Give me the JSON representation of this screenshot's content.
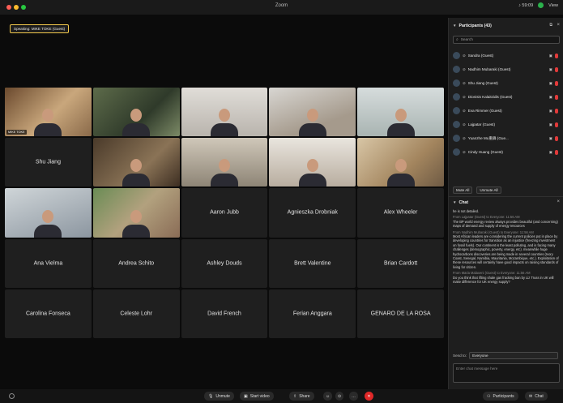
{
  "window": {
    "title": "Zoom",
    "right_label": "♪ 59:09",
    "right_view": "View",
    "speaking_label": "Speaking: MIKE TOKE (Guest)"
  },
  "grid": {
    "tiles": [
      {
        "name": "",
        "video": true,
        "bg": "bg-1",
        "caption": "MIKE TOKE",
        "active": true
      },
      {
        "name": "",
        "video": true,
        "bg": "bg-2",
        "caption": ""
      },
      {
        "name": "",
        "video": true,
        "bg": "bg-3",
        "caption": ""
      },
      {
        "name": "",
        "video": true,
        "bg": "bg-4",
        "caption": ""
      },
      {
        "name": "",
        "video": true,
        "bg": "bg-5",
        "caption": ""
      },
      {
        "name": "Shu Jiang",
        "video": false
      },
      {
        "name": "",
        "video": true,
        "bg": "bg-6",
        "caption": ""
      },
      {
        "name": "",
        "video": true,
        "bg": "bg-7",
        "caption": ""
      },
      {
        "name": "",
        "video": true,
        "bg": "bg-8",
        "caption": ""
      },
      {
        "name": "",
        "video": true,
        "bg": "bg-9",
        "caption": ""
      },
      {
        "name": "",
        "video": true,
        "bg": "bg-10",
        "caption": ""
      },
      {
        "name": "",
        "video": true,
        "bg": "bg-11",
        "caption": ""
      },
      {
        "name": "Aaron Jubb",
        "video": false
      },
      {
        "name": "Agnieszka Drobniak",
        "video": false
      },
      {
        "name": "Alex Wheeler",
        "video": false
      },
      {
        "name": "Ana Vielma",
        "video": false
      },
      {
        "name": "Andrea Schito",
        "video": false
      },
      {
        "name": "Ashley Douds",
        "video": false
      },
      {
        "name": "Brett Valentine",
        "video": false
      },
      {
        "name": "Brian Cardott",
        "video": false
      },
      {
        "name": "Carolina Fonseca",
        "video": false
      },
      {
        "name": "Celeste Lohr",
        "video": false
      },
      {
        "name": "David French",
        "video": false
      },
      {
        "name": "Ferian Anggara",
        "video": false
      },
      {
        "name": "GENARO DE LA ROSA",
        "video": false
      }
    ]
  },
  "participants": {
    "title": "Participants (43)",
    "search_placeholder": "Search",
    "list": [
      {
        "name": "Sandra (Guest)"
      },
      {
        "name": "Nadhim Mubaraki (Guest)"
      },
      {
        "name": "Shu Jiang (Guest)"
      },
      {
        "name": "Dionisis Kalaitzidis (Guest)"
      },
      {
        "name": "Eva Rimmer (Guest)"
      },
      {
        "name": "Lajpatar (Guest)"
      },
      {
        "name": "Yuanzhe Mu重鋒 (Gue..."
      },
      {
        "name": "Cindy Huang (Guest)"
      }
    ],
    "mute_all": "Mute All",
    "unmute_all": "Unmute All"
  },
  "chat": {
    "title": "Chat",
    "messages": [
      {
        "from": "",
        "text": "he is not detailed."
      },
      {
        "from": "From Lajpatar (Guest) to Everyone:   11:56 AM",
        "text": "The BP world energy review always provides beautiful (and concerning) maps of demand and supply of energy resources"
      },
      {
        "from": "From Nadhim Mubaraki (Guest) to Everyone:   11:56 AM",
        "text": "Most African leaders are considering the current policies put in place by developing countries for transition as an injustice (freezing investment on fossil fuels). Our continent is the least polluting, and is facing many challenges (demographic, poverty, energy, etc). meanwhile huge hydrocarbons discoveries are being made in several countries (Ivory Coast, Senegal, Namibia, Mauritania, Mozambique, etc.). Exploitation of these resources will certainly have good impacts on raising standards of living for citizen."
      },
      {
        "from": "From Maria Malaxeni (Guest) to Everyone:   11:56 AM",
        "text": "Do you think that lifting shale gas fracking ban by Liz Truss in UK will make difference for UK energy supply?"
      }
    ],
    "send_to_label": "Send to:",
    "send_to_value": "Everyone",
    "input_placeholder": "Enter chat message here"
  },
  "toolbar": {
    "unmute": "Unmute",
    "start_video": "Start video",
    "share": "Share",
    "participants": "Participants",
    "chat": "Chat"
  },
  "colors": {
    "speaking_border": "#f2c94c",
    "leave_red": "#e02828"
  }
}
